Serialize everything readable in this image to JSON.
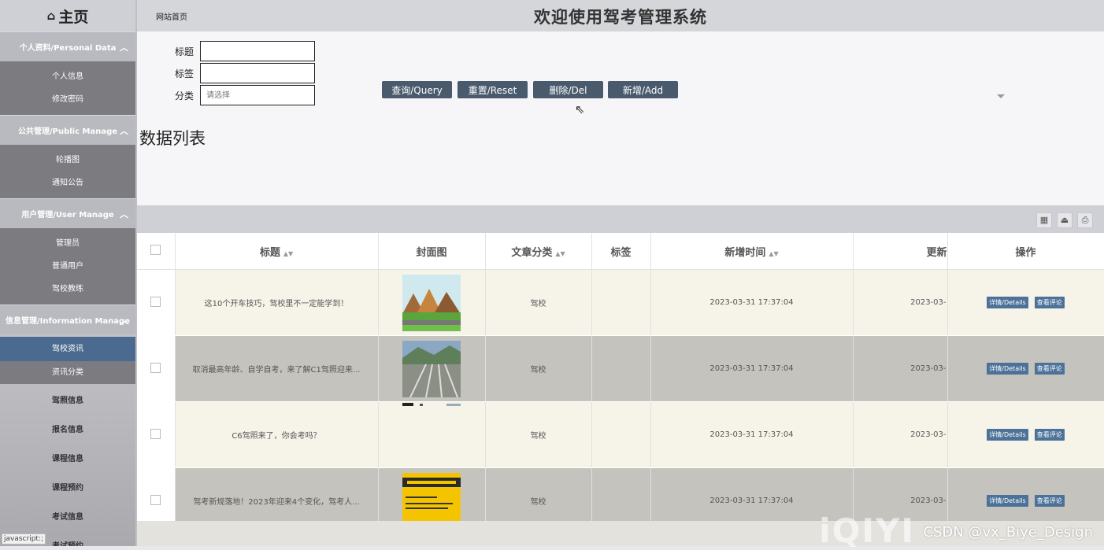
{
  "sidebar": {
    "home_label": "主页",
    "groups": [
      {
        "title": "个人资料/Personal Data",
        "items": [
          "个人信息",
          "修改密码"
        ]
      },
      {
        "title": "公共管理/Public Manage",
        "items": [
          "轮播图",
          "通知公告"
        ]
      },
      {
        "title": "用户管理/User Manage",
        "items": [
          "管理员",
          "普通用户",
          "驾校教练"
        ]
      },
      {
        "title": "信息管理/Information Manage",
        "items": [
          "驾校资讯",
          "资讯分类"
        ]
      }
    ],
    "plain_items": [
      "驾照信息",
      "报名信息",
      "课程信息",
      "课程预约",
      "考试信息",
      "考试预约"
    ],
    "status_tip": "javascript:;"
  },
  "header": {
    "breadcrumb": "网站首页",
    "title": "欢迎使用驾考管理系统"
  },
  "search": {
    "title_label": "标题",
    "tag_label": "标签",
    "category_label": "分类",
    "category_placeholder": "请选择",
    "buttons": {
      "query": "查询/Query",
      "reset": "重置/Reset",
      "delete": "删除/Del",
      "add": "新增/Add"
    }
  },
  "list_title": "数据列表",
  "table": {
    "headers": {
      "title": "标题",
      "cover": "封面图",
      "category": "文章分类",
      "tag": "标签",
      "created": "新增时间",
      "updated": "更新",
      "ops": "操作"
    },
    "rows": [
      {
        "title": "这10个开车技巧，驾校里不一定能学到！",
        "category": "驾校",
        "tag": "",
        "created": "2023-03-31 17:37:04",
        "updated": "2023-03-"
      },
      {
        "title": "取消最高年龄、自学自考，来了解C1驾照迎来...",
        "category": "驾校",
        "tag": "",
        "created": "2023-03-31 17:37:04",
        "updated": "2023-03-"
      },
      {
        "title": "C6驾照来了，你会考吗？",
        "category": "驾校",
        "tag": "",
        "created": "2023-03-31 17:37:04",
        "updated": "2023-03-"
      },
      {
        "title": "驾考新规落地！2023年迎来4个变化，驾考人...",
        "category": "驾校",
        "tag": "",
        "created": "2023-03-31 17:37:04",
        "updated": "2023-03-"
      }
    ],
    "op_details": "详情/Details",
    "op_comments": "查看评论"
  },
  "watermark": {
    "brand": "iQIYI",
    "text": "CSDN @vx_Biye_Design"
  },
  "colors": {
    "accent": "#4a5a6d",
    "active_nav": "#4a6b8f",
    "op_button": "#4c7299"
  }
}
